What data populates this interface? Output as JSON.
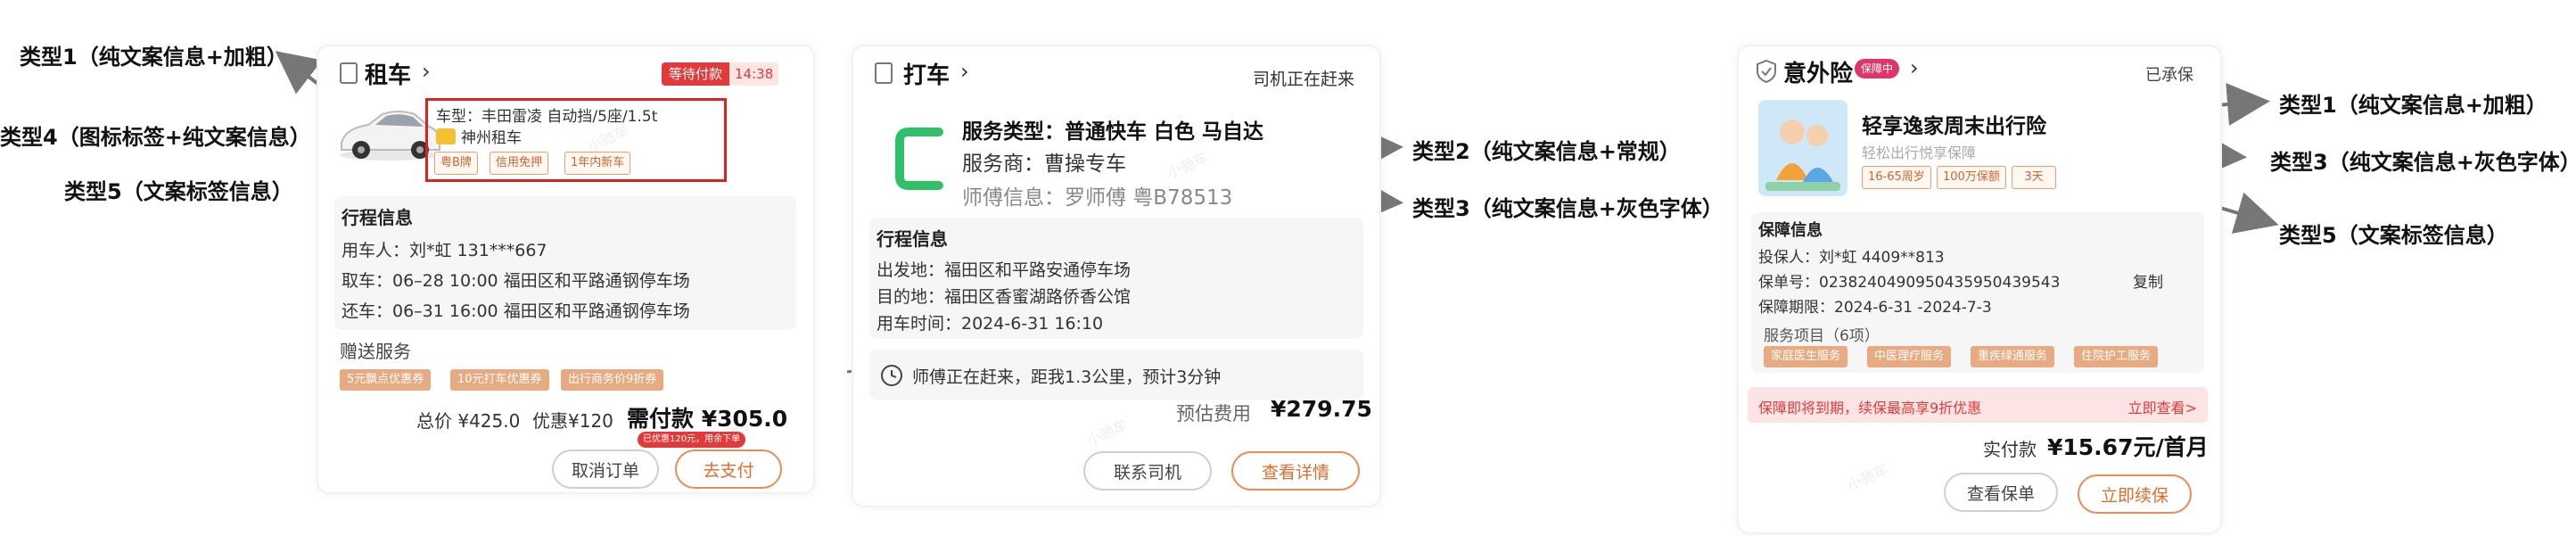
{
  "annotations": {
    "left_type1": "类型1（纯文案信息+加粗）",
    "left_type4": "类型4（图标标签+纯文案信息）",
    "left_type5": "类型5（文案标签信息）",
    "mid_type2": "类型2（纯文案信息+常规）",
    "mid_type3": "类型3（纯文案信息+灰色字体）",
    "right_type1": "类型1（纯文案信息+加粗）",
    "right_type3": "类型3（纯文案信息+灰色字体）",
    "right_type5": "类型5（文案标签信息）"
  },
  "rental": {
    "title": "租车",
    "status_badge": "等待付款",
    "countdown": "14:38",
    "car_model": "车型：丰田雷凌 自动挡/5座/1.5t",
    "company": "神州租车",
    "tags": [
      "粤B牌",
      "信用免押",
      "1年内新车"
    ],
    "trip_title": "行程信息",
    "renter": "用车人：刘*虹    131***667",
    "pickup": "取车：06–28 10:00  福田区和平路通钢停车场",
    "return": "还车：06–31 16:00  福田区和平路通钢停车场",
    "gift_title": "赠送服务",
    "gifts": [
      "5元飘点优惠券",
      "10元打车优惠券",
      "出行商务价9折券"
    ],
    "total": "总价 ¥425.0",
    "discount": "优惠¥120",
    "pay_due": "需付款 ¥305.0",
    "pay_note": "已优惠120元，用余下单",
    "cancel_label": "取消订单",
    "pay_label": "去支付"
  },
  "taxi": {
    "title": "打车",
    "status": "司机正在赶来",
    "service_type": "服务类型：普通快车 白色 马自达",
    "provider": "服务商：曹操专车",
    "driver": "师傅信息：罗师傅 粤B78513",
    "trip_title": "行程信息",
    "origin": "出发地：福田区和平路安通停车场",
    "destination": "目的地：福田区香蜜湖路侨香公馆",
    "time": "用车时间：2024-6-31  16:10",
    "eta": "师傅正在赶来，距我1.3公里，预计3分钟",
    "fare_label": "预估费用",
    "fare": "¥279.75",
    "contact_label": "联系司机",
    "details_label": "查看详情"
  },
  "insurance": {
    "title": "意外险",
    "badge": "保障中",
    "status": "已承保",
    "product": "轻享逸家周末出行险",
    "subtitle": "轻松出行悦享保障",
    "tags": [
      "16-65周岁",
      "100万保额",
      "3天"
    ],
    "cover_title": "保障信息",
    "holder": "投保人：刘*虹 4409**813",
    "policy_no": "保单号：0238240490950435950439543",
    "copy_label": "复制",
    "period": "保障期限：2024-6-31 -2024-7-3",
    "items_title": "服务项目（6项）",
    "items": [
      "家庭医生服务",
      "中医理疗服务",
      "重疾绿通服务",
      "住院护工服务"
    ],
    "renew_notice": "保障即将到期，续保最高享9折优惠",
    "renew_link": "立即查看>",
    "paid_label": "实付款",
    "paid_value": "¥15.67元/首月",
    "view_label": "查看保单",
    "renew_label": "立即续保"
  },
  "colors": {
    "accent": "#e66a2a",
    "danger": "#e23a3a",
    "arrow": "#777777"
  }
}
